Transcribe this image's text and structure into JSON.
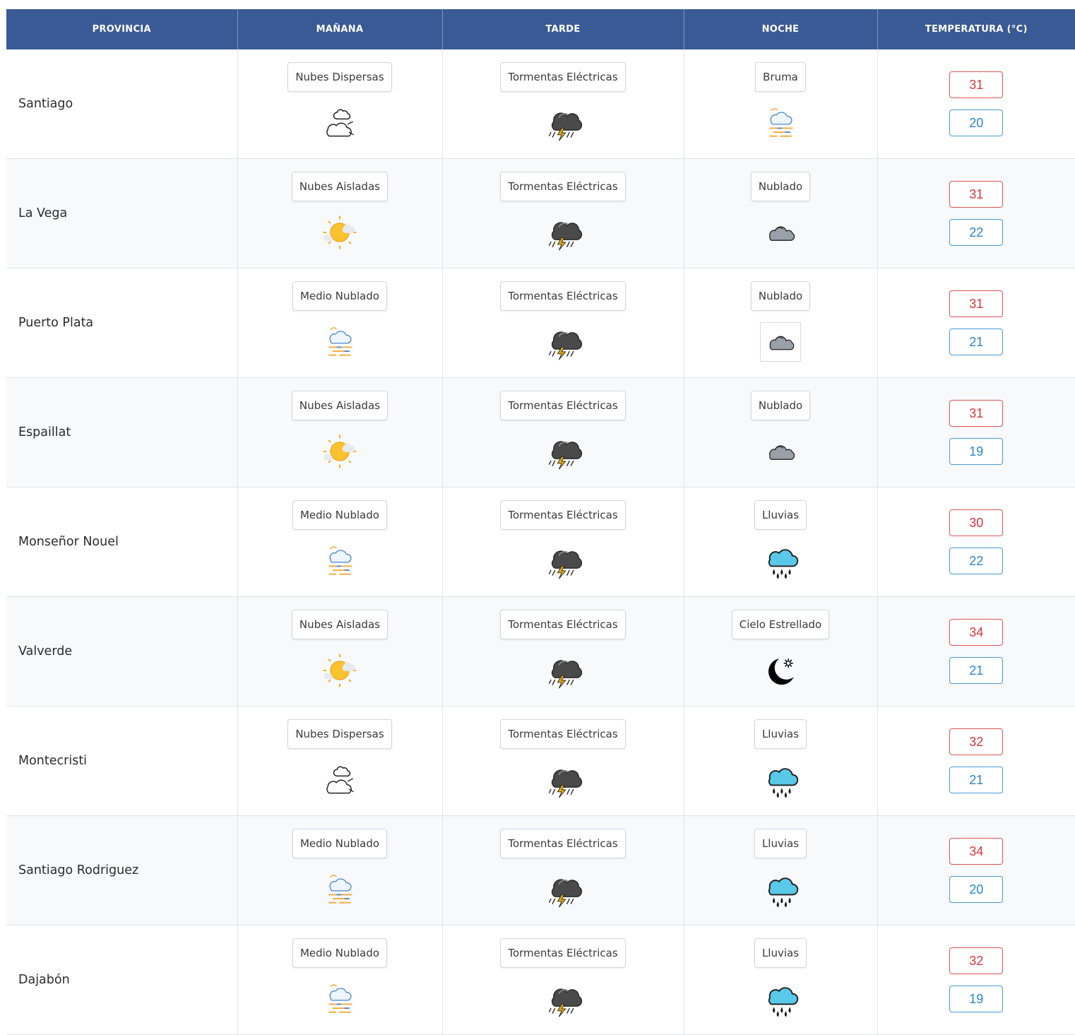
{
  "header": {
    "provincia": "PROVINCIA",
    "manana": "MAÑANA",
    "tarde": "TARDE",
    "noche": "NOCHE",
    "temperatura": "TEMPERATURA (°C)"
  },
  "rows": [
    {
      "provincia": "Santiago",
      "manana": {
        "label": "Nubes Dispersas",
        "icon": "scattered-clouds-icon"
      },
      "tarde": {
        "label": "Tormentas Eléctricas",
        "icon": "thunderstorm-icon"
      },
      "noche": {
        "label": "Bruma",
        "icon": "mist-icon"
      },
      "max": "31",
      "min": "20"
    },
    {
      "provincia": "La Vega",
      "manana": {
        "label": "Nubes Aisladas",
        "icon": "sun-cloud-icon"
      },
      "tarde": {
        "label": "Tormentas Eléctricas",
        "icon": "thunderstorm-icon"
      },
      "noche": {
        "label": "Nublado",
        "icon": "cloudy-icon"
      },
      "max": "31",
      "min": "22"
    },
    {
      "provincia": "Puerto Plata",
      "manana": {
        "label": "Medio Nublado",
        "icon": "mist-icon"
      },
      "tarde": {
        "label": "Tormentas Eléctricas",
        "icon": "thunderstorm-icon"
      },
      "noche": {
        "label": "Nublado",
        "icon": "cloudy-icon"
      },
      "max": "31",
      "min": "21"
    },
    {
      "provincia": "Espaillat",
      "manana": {
        "label": "Nubes Aisladas",
        "icon": "sun-cloud-icon"
      },
      "tarde": {
        "label": "Tormentas Eléctricas",
        "icon": "thunderstorm-icon"
      },
      "noche": {
        "label": "Nublado",
        "icon": "cloudy-icon"
      },
      "max": "31",
      "min": "19"
    },
    {
      "provincia": "Monseñor Nouel",
      "manana": {
        "label": "Medio Nublado",
        "icon": "mist-icon"
      },
      "tarde": {
        "label": "Tormentas Eléctricas",
        "icon": "thunderstorm-icon"
      },
      "noche": {
        "label": "Lluvias",
        "icon": "rain-icon"
      },
      "max": "30",
      "min": "22"
    },
    {
      "provincia": "Valverde",
      "manana": {
        "label": "Nubes Aisladas",
        "icon": "sun-cloud-icon"
      },
      "tarde": {
        "label": "Tormentas Eléctricas",
        "icon": "thunderstorm-icon"
      },
      "noche": {
        "label": "Cielo Estrellado",
        "icon": "moon-star-icon"
      },
      "max": "34",
      "min": "21"
    },
    {
      "provincia": "Montecristi",
      "manana": {
        "label": "Nubes Dispersas",
        "icon": "scattered-clouds-icon"
      },
      "tarde": {
        "label": "Tormentas Eléctricas",
        "icon": "thunderstorm-icon"
      },
      "noche": {
        "label": "Lluvias",
        "icon": "rain-icon"
      },
      "max": "32",
      "min": "21"
    },
    {
      "provincia": "Santiago Rodriguez",
      "manana": {
        "label": "Medio Nublado",
        "icon": "mist-icon"
      },
      "tarde": {
        "label": "Tormentas Eléctricas",
        "icon": "thunderstorm-icon"
      },
      "noche": {
        "label": "Lluvias",
        "icon": "rain-icon"
      },
      "max": "34",
      "min": "20"
    },
    {
      "provincia": "Dajabón",
      "manana": {
        "label": "Medio Nublado",
        "icon": "mist-icon"
      },
      "tarde": {
        "label": "Tormentas Eléctricas",
        "icon": "thunderstorm-icon"
      },
      "noche": {
        "label": "Lluvias",
        "icon": "rain-icon"
      },
      "max": "32",
      "min": "19"
    }
  ],
  "colors": {
    "header_bg": "#3a5a96",
    "max_temp": "#d9363e",
    "min_temp": "#2b86cf"
  }
}
